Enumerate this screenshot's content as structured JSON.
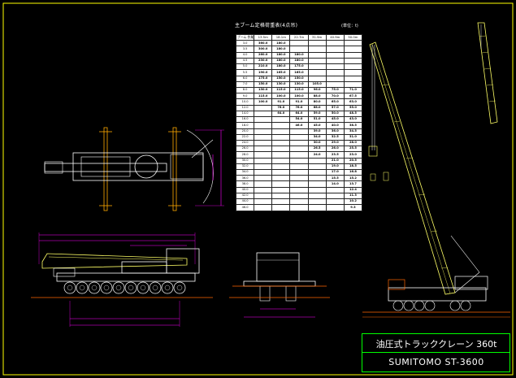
{
  "drawing": {
    "table_title": "主ブーム定格荷重表(4点吊)",
    "unit": "(単位：t)",
    "title_line1": "油圧式トラッククレーン 360t",
    "title_line2": "SUMITOMO ST-3600"
  },
  "load_table": {
    "header": [
      "ブーム\n作業半径\n(m)",
      "13.5m",
      "18.1m",
      "22.7m",
      "31.9m",
      "40.9m",
      "50.0m"
    ],
    "rows": [
      [
        "3.0",
        "360.0",
        "180.0",
        "",
        "",
        "",
        ""
      ],
      [
        "3.5",
        "300.0",
        "180.0",
        "",
        "",
        "",
        ""
      ],
      [
        "4.0",
        "260.0",
        "180.0",
        "180.0",
        "",
        "",
        ""
      ],
      [
        "4.5",
        "230.0",
        "180.0",
        "180.0",
        "",
        "",
        ""
      ],
      [
        "5.0",
        "210.0",
        "180.0",
        "175.0",
        "",
        "",
        ""
      ],
      [
        "5.5",
        "190.0",
        "165.0",
        "165.0",
        "",
        "",
        ""
      ],
      [
        "6.0",
        "175.0",
        "150.0",
        "150.0",
        "",
        "",
        ""
      ],
      [
        "7.0",
        "150.0",
        "130.0",
        "130.0",
        "105.0",
        "",
        ""
      ],
      [
        "8.0",
        "130.0",
        "115.0",
        "115.0",
        "96.0",
        "75.0",
        "71.0"
      ],
      [
        "9.0",
        "115.0",
        "100.0",
        "100.0",
        "88.0",
        "70.0",
        "67.5"
      ],
      [
        "10.0",
        "100.0",
        "91.0",
        "91.0",
        "80.0",
        "65.0",
        "63.0"
      ],
      [
        "12.0",
        "",
        "76.0",
        "76.0",
        "68.0",
        "57.0",
        "55.0"
      ],
      [
        "14.0",
        "",
        "64.0",
        "64.0",
        "59.0",
        "50.0",
        "48.5"
      ],
      [
        "16.0",
        "",
        "",
        "54.0",
        "51.0",
        "45.0",
        "43.0"
      ],
      [
        "18.0",
        "",
        "",
        "46.0",
        "45.0",
        "40.0",
        "38.5"
      ],
      [
        "20.0",
        "",
        "",
        "",
        "39.0",
        "36.0",
        "34.5"
      ],
      [
        "22.0",
        "",
        "",
        "",
        "34.0",
        "32.5",
        "31.0"
      ],
      [
        "24.0",
        "",
        "",
        "",
        "30.0",
        "29.0",
        "28.0"
      ],
      [
        "26.0",
        "",
        "",
        "",
        "26.5",
        "26.0",
        "25.5"
      ],
      [
        "28.0",
        "",
        "",
        "",
        "24.0",
        "23.5",
        "23.0"
      ],
      [
        "30.0",
        "",
        "",
        "",
        "",
        "21.0",
        "20.5"
      ],
      [
        "32.0",
        "",
        "",
        "",
        "",
        "19.0",
        "18.5"
      ],
      [
        "34.0",
        "",
        "",
        "",
        "",
        "17.0",
        "16.8"
      ],
      [
        "36.0",
        "",
        "",
        "",
        "",
        "15.5",
        "15.2"
      ],
      [
        "38.0",
        "",
        "",
        "",
        "",
        "14.0",
        "13.7"
      ],
      [
        "40.0",
        "",
        "",
        "",
        "",
        "",
        "12.4"
      ],
      [
        "42.0",
        "",
        "",
        "",
        "",
        "",
        "11.3"
      ],
      [
        "44.0",
        "",
        "",
        "",
        "",
        "",
        "10.2"
      ],
      [
        "46.0",
        "",
        "",
        "",
        "",
        "",
        "9.3"
      ]
    ]
  },
  "colors": {
    "boom": "#ffff66",
    "body": "#ffffff",
    "dimension": "#ff00ff",
    "outrigger": "#ff6600",
    "frame": "#ffff00",
    "title_border": "#00ff00"
  }
}
